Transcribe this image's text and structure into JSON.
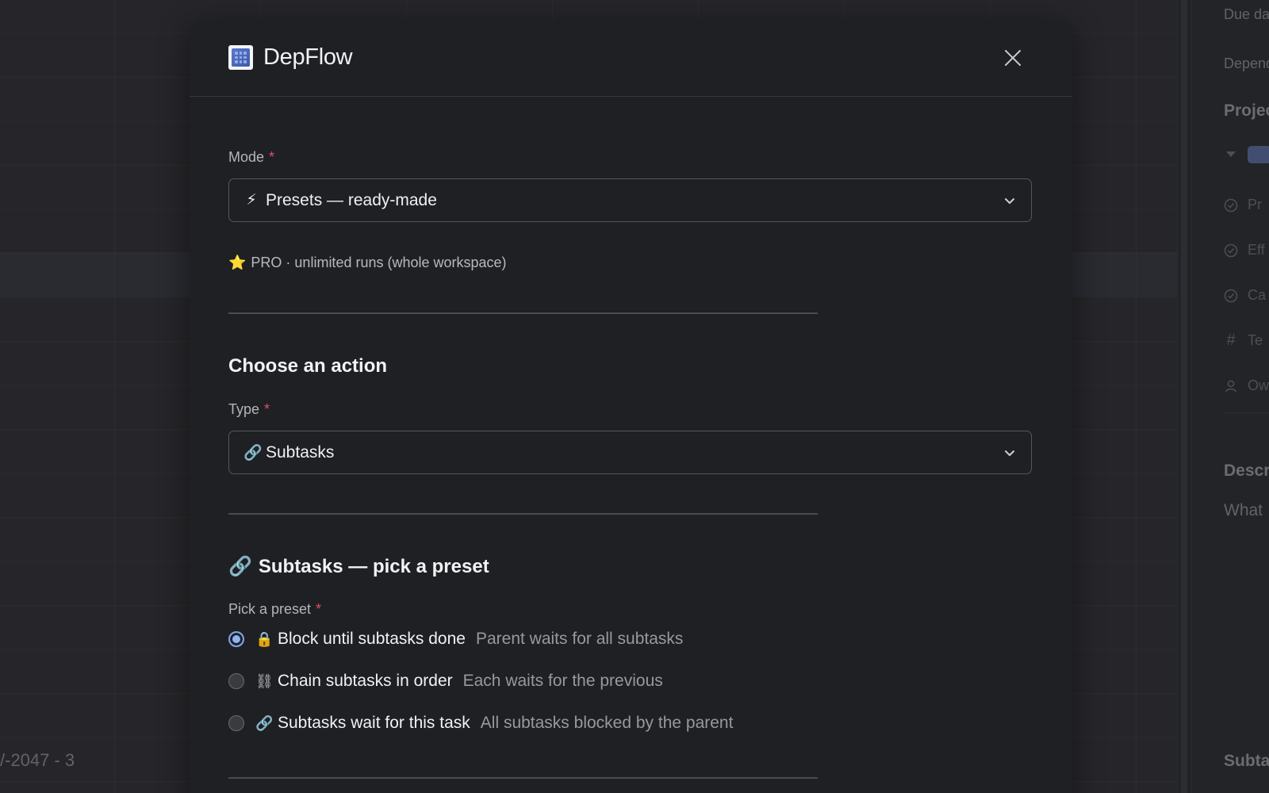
{
  "background": {
    "bottom_left_text": "/-2047 - 3",
    "right_panel": {
      "due_date": "Due date",
      "dependencies": "Dependencies",
      "project": "Project",
      "rows": [
        "Pr",
        "Eff",
        "Ca",
        "Te",
        "Ow"
      ],
      "description_heading": "Description",
      "description_placeholder": "What",
      "subtasks_heading": "Subtasks"
    }
  },
  "modal": {
    "app_name": "DepFlow",
    "mode": {
      "label": "Mode",
      "required": "*",
      "icon": "⚡",
      "value": "Presets — ready-made"
    },
    "plan_info": {
      "icon": "⭐",
      "text": "PRO · unlimited runs (whole workspace)"
    },
    "action_section": {
      "title": "Choose an action",
      "type_label": "Type",
      "required": "*",
      "type_icon": "🔗",
      "type_value": "Subtasks"
    },
    "preset_section": {
      "icon": "🔗",
      "title": "Subtasks — pick a preset",
      "label": "Pick a preset",
      "required": "*",
      "options": [
        {
          "icon": "🔒",
          "title": "Block until subtasks done",
          "desc": "Parent waits for all subtasks",
          "checked": true
        },
        {
          "icon": "⛓",
          "title": "Chain subtasks in order",
          "desc": "Each waits for the previous",
          "checked": false
        },
        {
          "icon": "🔗",
          "title": "Subtasks wait for this task",
          "desc": "All subtasks blocked by the parent",
          "checked": false
        }
      ]
    }
  },
  "colors": {
    "modal_bg": "#1f2023",
    "page_bg": "#2f3034",
    "required": "#e0506a",
    "radio_checked": "#8fb3f2"
  }
}
